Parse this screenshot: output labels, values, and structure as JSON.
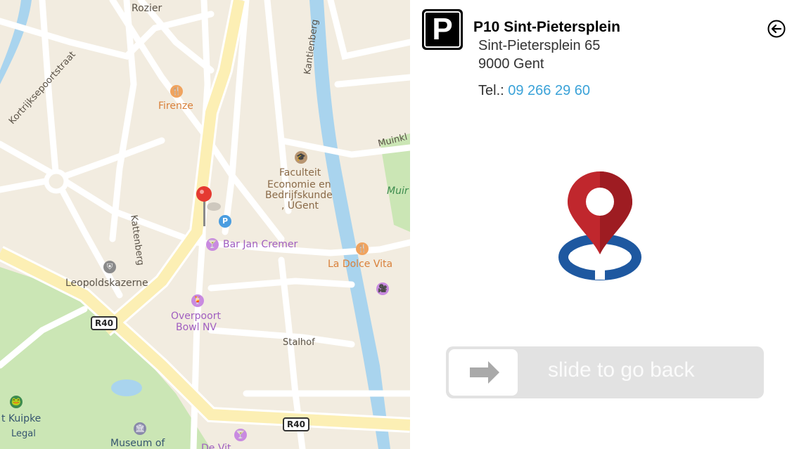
{
  "map": {
    "streets": {
      "rozier": "Rozier",
      "kortrijksepoortstraat": "Kortrijksepoortstraat",
      "kantienberg": "Kantienberg",
      "kattenberg": "Kattenberg",
      "stalhof": "Stalhof",
      "muinkl": "Muinkl"
    },
    "places": {
      "firenze": "Firenze",
      "faculteit": [
        "Faculteit",
        "Economie en",
        "Bedrijfskunde",
        ", UGent"
      ],
      "bar_jan_cremer": "Bar Jan Cremer",
      "la_dolce_vita": "La Dolce Vita",
      "leopoldskazerne": "Leopoldskazerne",
      "overpoort": [
        "Overpoort",
        "Bowl NV"
      ],
      "muir": "Muir",
      "kuipke": "t Kuipke",
      "museum": "Museum of",
      "de_vitrine_partial": "De Vit",
      "legal": "Legal"
    },
    "road_shields": [
      "R40",
      "R40"
    ],
    "icons": [
      "restaurant-icon",
      "university-icon",
      "parking-icon",
      "bar-icon",
      "shield-poi-icon",
      "cinema-icon",
      "museum-icon",
      "zoo-icon",
      "map-pin-icon"
    ],
    "colors": {
      "water": "#a9d4ee",
      "park": "#cbe6b5",
      "major_road": "#fcefb4",
      "pin": "#e53a31"
    }
  },
  "panel": {
    "logo_letter": "P",
    "title": "P10 Sint-Pietersplein",
    "address_line1": "Sint-Pietersplein 65",
    "address_line2": "9000 Gent",
    "tel_label": "Tel.:",
    "tel_number": "09 266 29 60",
    "back_icon": "arrow-left-circle-icon",
    "location_icon": "location-target-icon",
    "slider_label": "slide to go back",
    "slider_icon": "arrow-right-icon",
    "colors": {
      "link": "#3aa2d8",
      "pin_red": "#c0272d",
      "target_blue": "#1e58a0"
    }
  }
}
